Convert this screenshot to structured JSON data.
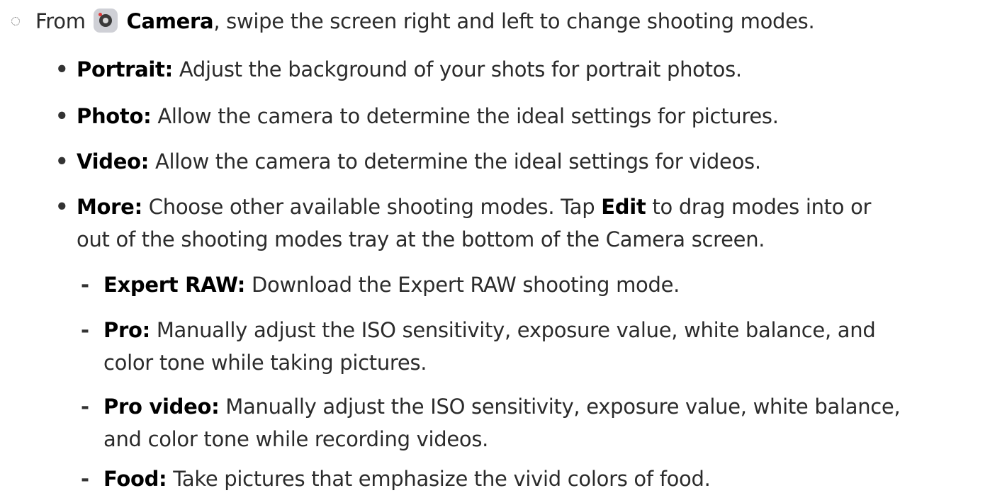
{
  "step": {
    "prefix": "From ",
    "app_name": "Camera",
    "suffix": ", swipe the screen right and left to change shooting modes."
  },
  "modes": [
    {
      "term": "Portrait",
      "sep": ":",
      "desc": " Adjust the background of your shots for portrait photos."
    },
    {
      "term": "Photo",
      "sep": ":",
      "desc": " Allow the camera to determine the ideal settings for pictures."
    },
    {
      "term": "Video",
      "sep": ":",
      "desc": " Allow the camera to determine the ideal settings for videos."
    },
    {
      "term": "More",
      "sep": ":",
      "desc_part1": " Choose other available shooting modes. Tap ",
      "edit_label": "Edit",
      "desc_part2": " to drag modes into or",
      "desc_line2": "out of the shooting modes tray at the bottom of the Camera screen."
    }
  ],
  "more_modes": [
    {
      "term": "Expert RAW",
      "sep": ":",
      "desc": " Download the Expert RAW shooting mode."
    },
    {
      "term": "Pro",
      "sep": ":",
      "desc": " Manually adjust the ISO sensitivity, exposure value, white balance, and",
      "desc_line2": "color tone while taking pictures."
    },
    {
      "term": "Pro video",
      "sep": ":",
      "desc": " Manually adjust the ISO sensitivity, exposure value, white balance,",
      "desc_line2": "and color tone while recording videos."
    },
    {
      "term": "Food",
      "sep": ":",
      "desc": " Take pictures that emphasize the vivid colors of food."
    }
  ],
  "icons": {
    "step_bullet": "dotted-circle-icon",
    "camera": "camera-app-icon"
  }
}
